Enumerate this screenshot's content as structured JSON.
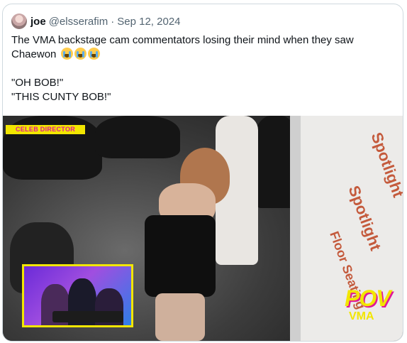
{
  "tweet": {
    "display_name": "joe",
    "handle": "@elsserafim",
    "separator": "·",
    "date": "Sep 12, 2024",
    "text_line1": "The VMA backstage cam commentators losing their mind when they saw",
    "text_line2": "Chaewon",
    "text_line3": "\"OH BOB!\"",
    "text_line4": "\"THIS CUNTY BOB!\"",
    "emoji_name": "loudly-crying-face-emoji",
    "emoji_count": 3
  },
  "video": {
    "badge": "CELEB DIRECTOR",
    "logo_main": "POV",
    "logo_sub": "VMA",
    "wall_text_1": "Spotlight",
    "wall_text_2": "Floor Seating",
    "accent_yellow": "#f2e600",
    "accent_pink": "#e0169a"
  }
}
